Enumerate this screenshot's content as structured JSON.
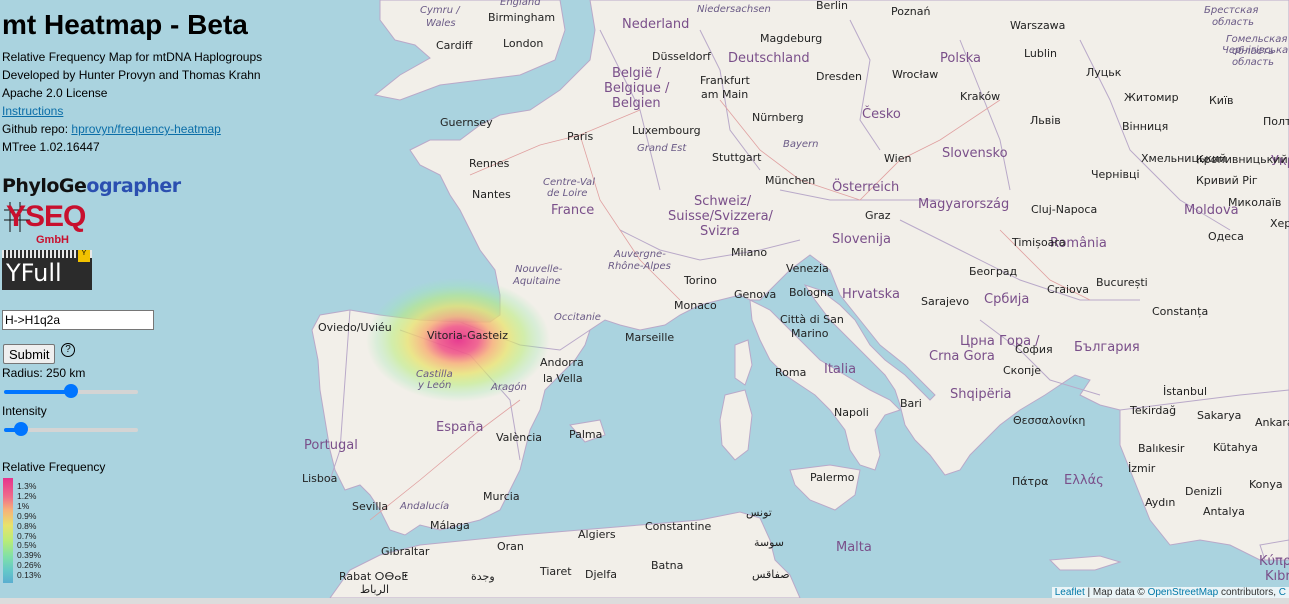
{
  "app": {
    "title": "mt Heatmap - Beta",
    "subtitle": "Relative Frequency Map for mtDNA Haplogroups",
    "developers": "Developed by Hunter Provyn and Thomas Krahn",
    "license": "Apache 2.0 License",
    "instructions_link": "Instructions",
    "github_label": "Github repo:",
    "github_link": "hprovyn/frequency-heatmap",
    "mtree": "MTree 1.02.16447"
  },
  "logos": {
    "phylogeographer_a": "PhyloGe",
    "phylogeographer_b": "ographer",
    "yseq": "YSEQ",
    "yseq_sub": "GmbH",
    "yfull": "YFull",
    "yfull_badge": "Y"
  },
  "controls": {
    "haplogroup_value": "H->H1q2a",
    "submit_label": "Submit",
    "help_icon": "?",
    "radius_label": "Radius: 250 km",
    "radius_fraction": 0.5,
    "intensity_label": "Intensity",
    "intensity_fraction": 0.08
  },
  "legend": {
    "title": "Relative Frequency",
    "ticks": [
      "1.3%",
      "1.2%",
      "1%",
      "0.9%",
      "0.8%",
      "0.7%",
      "0.5%",
      "0.39%",
      "0.26%",
      "0.13%"
    ]
  },
  "map": {
    "attribution_leaflet": "Leaflet",
    "attribution_sep": " | Map data © ",
    "attribution_osm": "OpenStreetMap",
    "attribution_tail": " contributors, ",
    "attribution_c": "C",
    "labels": {
      "nederland": "Nederland",
      "deutschland": "Deutschland",
      "polska": "Polska",
      "belgique": "België /",
      "belgique2": "Belgique /",
      "belgique3": "Belgien",
      "france": "France",
      "cesko": "Česko",
      "slovensko": "Slovensko",
      "osterreich": "Österreich",
      "magyarorszag": "Magyarország",
      "schweiz": "Schweiz/",
      "schweiz2": "Suisse/Svizzera/",
      "schweiz3": "Svizra",
      "slovenija": "Slovenija",
      "hrvatska": "Hrvatska",
      "romania": "România",
      "moldova": "Moldova",
      "srbija": "Србија",
      "crna_gora": "Црна Гора /",
      "crna_gora2": "Crna Gora",
      "balgariya": "България",
      "shqiperia": "Shqipëria",
      "italia": "Italia",
      "espana": "España",
      "portugal": "Portugal",
      "ellas": "Ελλάς",
      "malta": "Malta",
      "kypros": "Κύπρος",
      "kibris": "Kıbrıs",
      "ukr": "Укр",
      "cymru": "Cymru /",
      "wales": "Wales",
      "england": "England",
      "birmingham": "Birmingham",
      "cardiff": "Cardiff",
      "london": "London",
      "guernsey": "Guernsey",
      "paris": "Paris",
      "rennes": "Rennes",
      "nantes": "Nantes",
      "centre": "Centre-Val",
      "centre2": "de Loire",
      "nouvelle": "Nouvelle-",
      "nouvelle2": "Aquitaine",
      "occitanie": "Occitanie",
      "auvergne": "Auvergne-",
      "auvergne2": "Rhône-Alpes",
      "grand_est": "Grand Est",
      "luxembourg": "Luxembourg",
      "dusseldorf": "Düsseldorf",
      "frankfurt": "Frankfurt",
      "frankfurt2": "am Main",
      "stuttgart": "Stuttgart",
      "nurnberg": "Nürnberg",
      "munchen": "München",
      "bayern": "Bayern",
      "magdeburg": "Magdeburg",
      "dresden": "Dresden",
      "berlin": "Berlin",
      "niedersachsen": "Niedersachsen",
      "poznan": "Poznań",
      "warszawa": "Warszawa",
      "wroclaw": "Wrocław",
      "krakow": "Kraków",
      "lublin": "Lublin",
      "lutsk": "Луцьк",
      "lviv": "Львів",
      "zhytomyr": "Житомир",
      "kyiv": "Київ",
      "vinnytsia": "Вінниця",
      "chernivtsi": "Чернівці",
      "khmelnytskyi": "Хмельницький",
      "kropyvnytskyi": "Кропивницький",
      "kryvyi_rih": "Кривий Ріг",
      "mykolaiv": "Миколаїв",
      "odesa": "Одеса",
      "kher": "Хер",
      "polt": "Полт",
      "brest": "Брестская",
      "brest2": "область",
      "gomel": "Гомельская",
      "gomel2": "область",
      "chernihiv": "Чернігівська",
      "chernihiv2": "область",
      "wien": "Wien",
      "graz": "Graz",
      "cluj": "Cluj-Napoca",
      "timisoara": "Timișoara",
      "beograd": "Београд",
      "craiova": "Craiova",
      "bucuresti": "București",
      "constanta": "Constanța",
      "sarajevo": "Sarajevo",
      "sofia": "София",
      "skopje": "Скопје",
      "istanbul": "İstanbul",
      "tekirdag": "Tekirdağ",
      "sakarya": "Sakarya",
      "ankara": "Ankara",
      "balikesir": "Balıkesir",
      "kutahya": "Kütahya",
      "izmir": "İzmir",
      "konya": "Konya",
      "aydin": "Aydın",
      "antalya": "Antalya",
      "denizli": "Denizli",
      "thessaloniki": "Θεσσαλονίκη",
      "patra": "Πάτρα",
      "milano": "Milano",
      "torino": "Torino",
      "venezia": "Venezia",
      "bologna": "Bologna",
      "genova": "Genova",
      "monaco": "Monaco",
      "marseille": "Marseille",
      "citta": "Città di San",
      "citta2": "Marino",
      "roma": "Roma",
      "napoli": "Napoli",
      "bari": "Bari",
      "palermo": "Palermo",
      "oviedo": "Oviedo/Uviéu",
      "vitoria": "Vitoria-Gasteiz",
      "castilla": "Castilla",
      "castilla2": "y León",
      "aragon": "Aragón",
      "andorra": "Andorra",
      "andorra2": "la Vella",
      "valencia": "València",
      "palma": "Palma",
      "murcia": "Murcia",
      "sevilla": "Sevilla",
      "andalucia": "Andalucía",
      "malaga": "Málaga",
      "lisboa": "Lisboa",
      "gibraltar": "Gibraltar",
      "oran": "Oran",
      "algiers": "Algiers",
      "constantine": "Constantine",
      "tunis": "تونس",
      "sousse": "سوسة",
      "sfax": "صفاقس",
      "batna": "Batna",
      "tiaret": "Tiaret",
      "djelfa": "Djelfa",
      "oujda": "وجدة",
      "rabat": "Rabat ⵔⴱⴰⵟ",
      "rabat2": "الرباط"
    }
  }
}
